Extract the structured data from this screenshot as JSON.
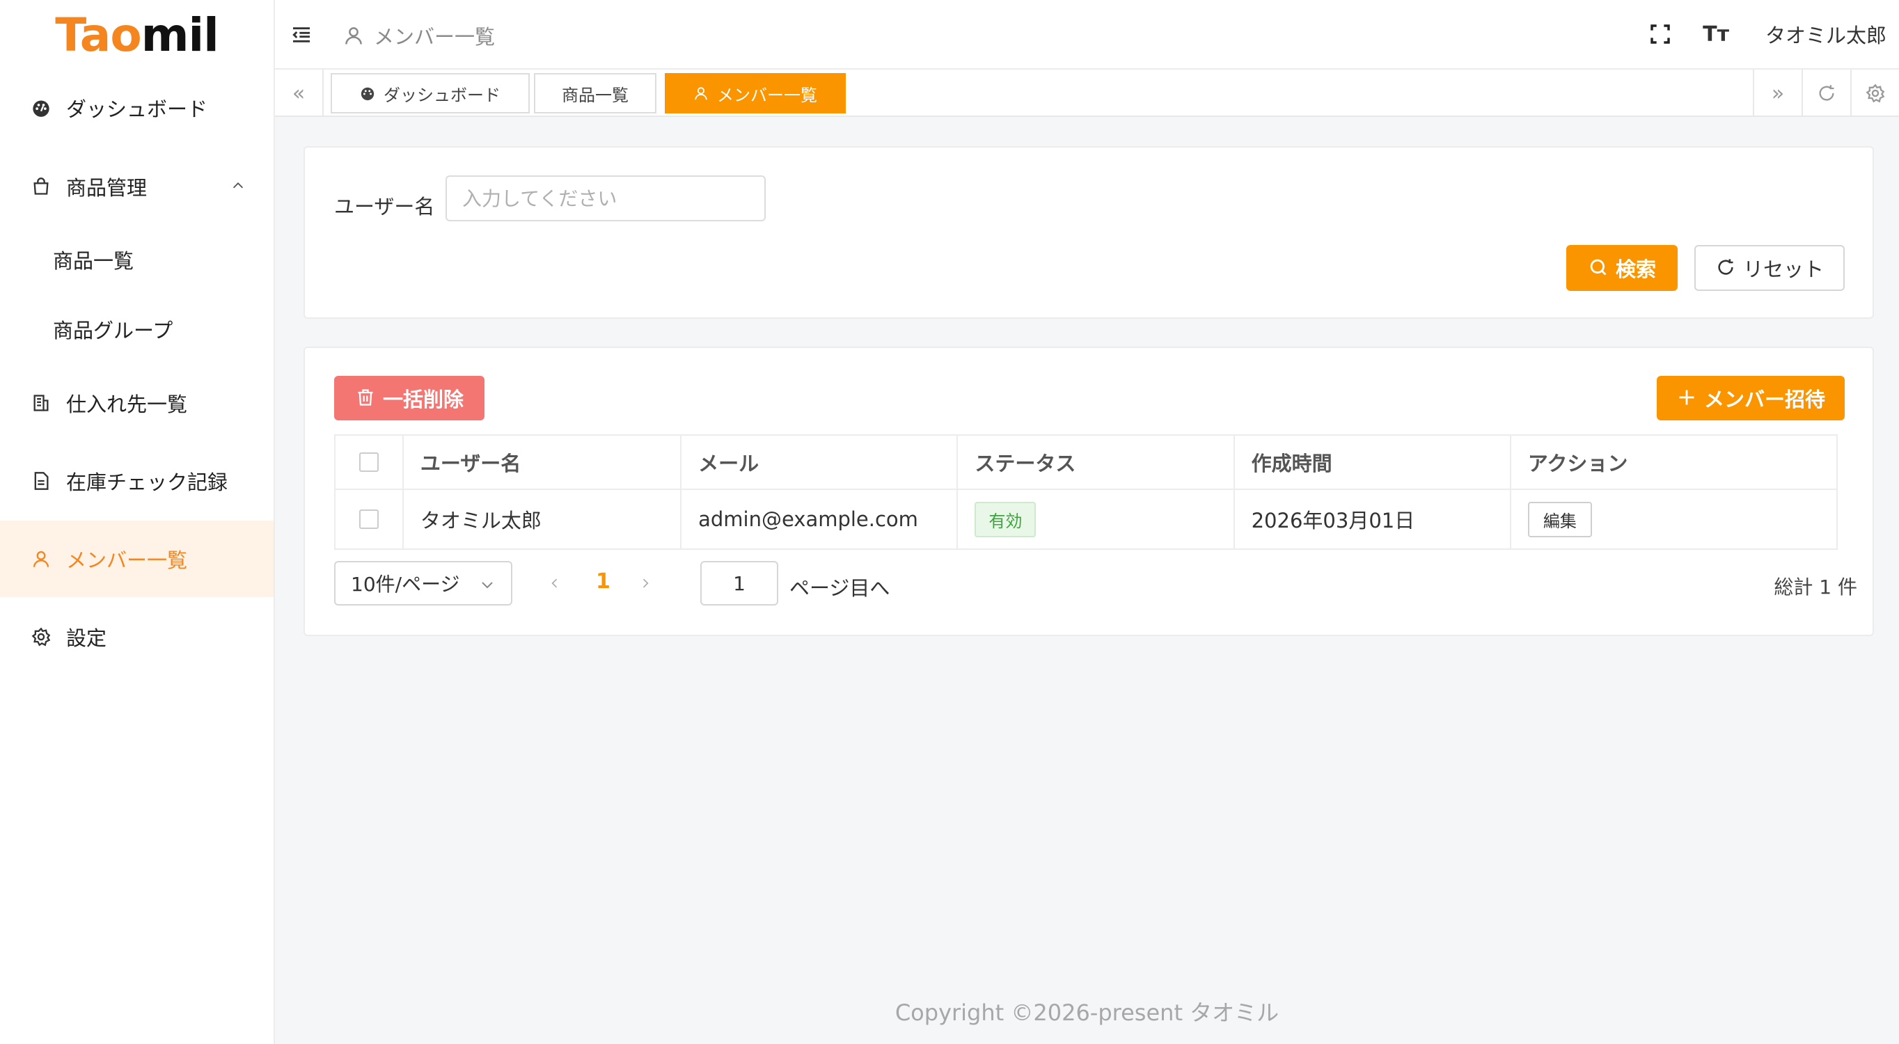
{
  "logo": {
    "part1": "Tao",
    "part2": "mil"
  },
  "sidebar": {
    "items": [
      {
        "label": "ダッシュボード",
        "icon": "dashboard-icon"
      },
      {
        "label": "商品管理",
        "icon": "shopping-bag-icon",
        "expanded": true
      },
      {
        "label": "商品一覧"
      },
      {
        "label": "商品グループ"
      },
      {
        "label": "仕入れ先一覧",
        "icon": "building-icon"
      },
      {
        "label": "在庫チェック記録",
        "icon": "document-icon"
      },
      {
        "label": "メンバー一覧",
        "icon": "user-icon",
        "active": true
      },
      {
        "label": "設定",
        "icon": "gear-icon"
      }
    ]
  },
  "header": {
    "breadcrumb": "メンバー一覧",
    "user_name": "タオミル太郎",
    "font_size_label": "Tт"
  },
  "tabs": [
    {
      "label": "ダッシュボード"
    },
    {
      "label": "商品一覧"
    },
    {
      "label": "メンバー一覧",
      "active": true
    }
  ],
  "search": {
    "label": "ユーザー名",
    "placeholder": "入力してください",
    "search_button": "検索",
    "reset_button": "リセット"
  },
  "toolbar": {
    "bulk_delete": "一括削除",
    "invite": "メンバー招待"
  },
  "table": {
    "headers": [
      "ユーザー名",
      "メール",
      "ステータス",
      "作成時間",
      "アクション"
    ],
    "rows": [
      {
        "name": "タオミル太郎",
        "email": "admin@example.com",
        "status": "有効",
        "created": "2026年03月01日",
        "action": "編集"
      }
    ]
  },
  "pagination": {
    "page_size": "10件/ページ",
    "current_page": "1",
    "jump_value": "1",
    "jump_label": "ページ目へ",
    "total": "総計 1 件"
  },
  "footer": "Copyright ©2026-present タオミル",
  "colors": {
    "accent": "#fa9500",
    "danger": "#f37672",
    "active_bg": "#fef3e6",
    "success": "#3aa53a"
  }
}
